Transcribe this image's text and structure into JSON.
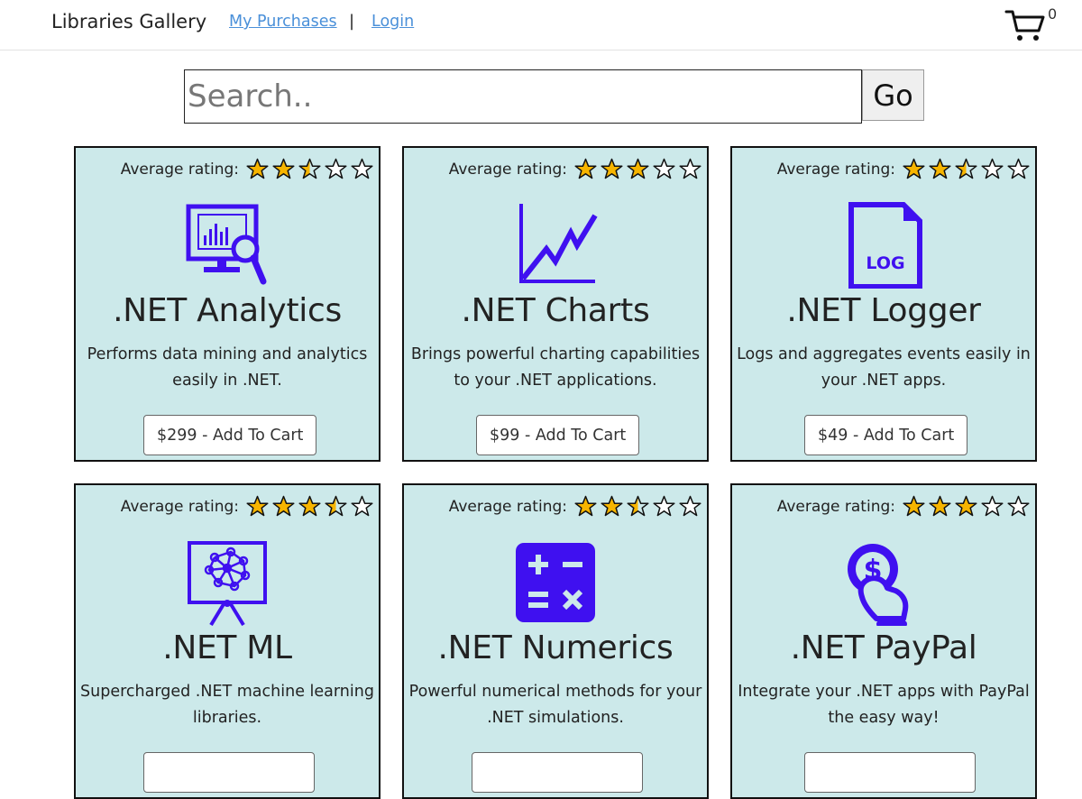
{
  "header": {
    "brand": "Libraries Gallery",
    "my_purchases": "My Purchases",
    "separator": "|",
    "login": "Login",
    "cart_count": "0"
  },
  "search": {
    "placeholder": "Search..",
    "go_label": "Go"
  },
  "rating_label": "Average rating:",
  "colors": {
    "card_bg": "#cce9ea",
    "icon": "#3f10f0",
    "star_fill": "#f7b500",
    "link": "#4a90d9"
  },
  "products": [
    {
      "name": ".NET Analytics",
      "description": "Performs data mining and analytics easily in .NET.",
      "button": "$299 - Add To Cart",
      "rating": 2.5,
      "icon": "monitor-chart-magnifier-icon"
    },
    {
      "name": ".NET Charts",
      "description": "Brings powerful charting capabilities to your .NET applications.",
      "button": "$99 - Add To Cart",
      "rating": 3,
      "icon": "line-chart-icon"
    },
    {
      "name": ".NET Logger",
      "description": "Logs and aggregates events easily in your .NET apps.",
      "button": "$49 - Add To Cart",
      "rating": 2.5,
      "icon": "log-file-icon"
    },
    {
      "name": ".NET ML",
      "description": "Supercharged .NET machine learning libraries.",
      "button": "",
      "rating": 3.5,
      "icon": "neural-network-board-icon"
    },
    {
      "name": ".NET Numerics",
      "description": "Powerful numerical methods for your .NET simulations.",
      "button": "",
      "rating": 2.5,
      "icon": "calculator-icon"
    },
    {
      "name": ".NET PayPal",
      "description": "Integrate your .NET apps with PayPal the easy way!",
      "button": "",
      "rating": 3,
      "icon": "hand-coin-icon"
    }
  ]
}
